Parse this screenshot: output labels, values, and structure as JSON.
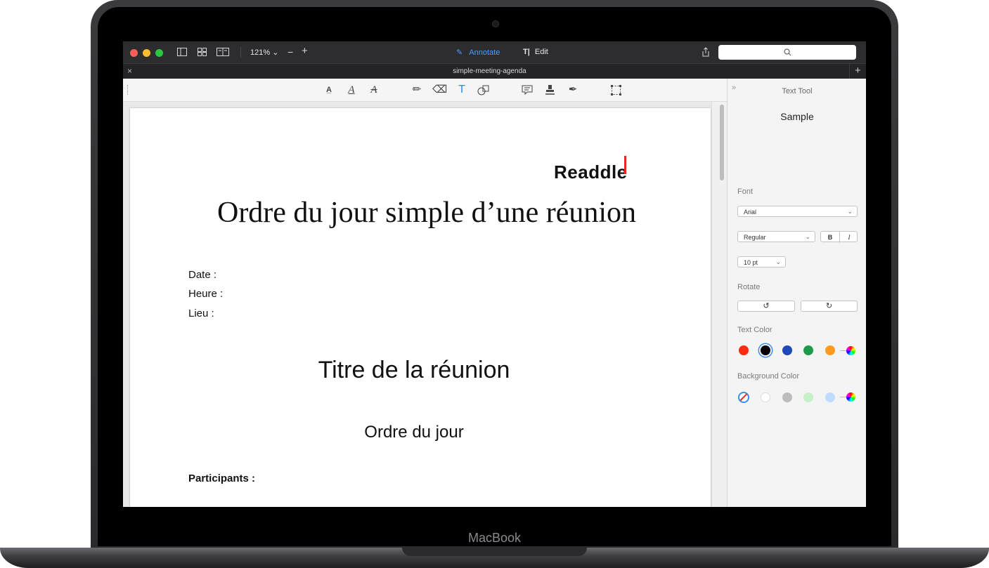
{
  "device": {
    "brand_label": "MacBook"
  },
  "toolbar": {
    "zoom_label": "121%",
    "annotate_label": "Annotate",
    "edit_label": "Edit",
    "search_placeholder": ""
  },
  "tab": {
    "title": "simple-meeting-agenda"
  },
  "document": {
    "logo_text": "Readdle",
    "title": "Ordre du jour simple d’une réunion",
    "fields": [
      "Date :",
      "Heure :",
      "Lieu :"
    ],
    "meeting_title": "Titre de la réunion",
    "agenda_heading": "Ordre du jour",
    "participants_label": "Participants :"
  },
  "sidebar": {
    "header": "Text Tool",
    "sample": "Sample",
    "font_label": "Font",
    "font_value": "Arial",
    "style_value": "Regular",
    "bold_label": "B",
    "italic_label": "I",
    "size_value": "10 pt",
    "rotate_label": "Rotate",
    "text_color_label": "Text Color",
    "background_color_label": "Background Color",
    "text_colors": [
      "#ff2a12",
      "#000000",
      "#1f47b8",
      "#1d9a4a",
      "#ff9a1f"
    ],
    "background_colors": [
      "#ffffff",
      "#bdbdbd",
      "#c8f0c8",
      "#bfdcff"
    ]
  },
  "colors": {
    "accent": "#3b8ee8",
    "readdle_red": "#e32b20"
  }
}
